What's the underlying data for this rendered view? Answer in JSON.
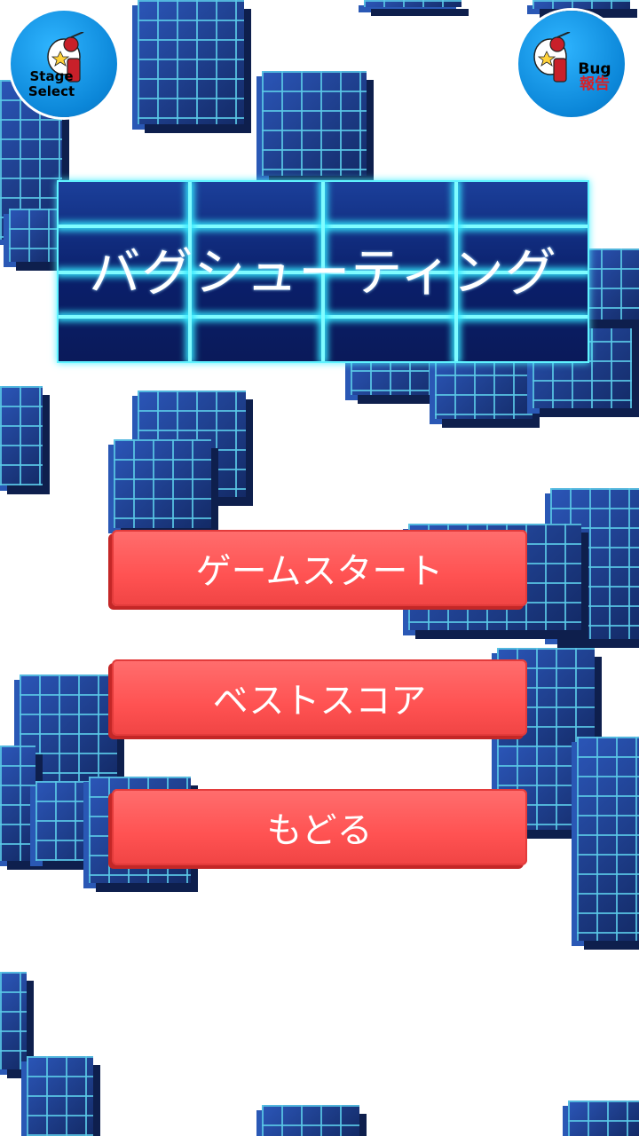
{
  "title": "バグシューティング",
  "top_left_button": {
    "line1": "Stage",
    "line2": "Select",
    "icon": "mascot-icon"
  },
  "top_right_button": {
    "line1": "Bug",
    "line2": "報告",
    "icon": "mascot-icon"
  },
  "menu": {
    "start_label": "ゲームスタート",
    "best_score_label": "ベストスコア",
    "back_label": "もどる"
  },
  "colors": {
    "button_red": "#ff5555",
    "title_neon": "#5ff2ff",
    "cube_blue": "#1f3f8a",
    "corner_blue": "#0b86d8"
  }
}
